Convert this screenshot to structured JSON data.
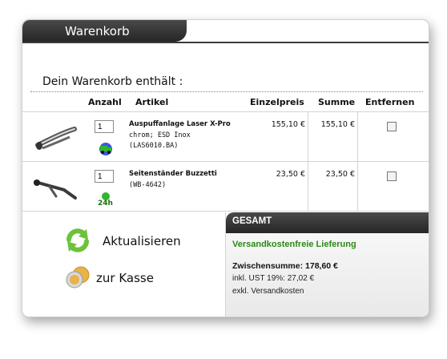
{
  "header": {
    "title": "Warenkorb"
  },
  "cart": {
    "intro": "Dein Warenkorb enthält :",
    "columns": {
      "quantity": "Anzahl",
      "article": "Artikel",
      "unit_price": "Einzelpreis",
      "total": "Summe",
      "remove": "Entfernen"
    },
    "items": [
      {
        "quantity": "1",
        "name": "Auspuffanlage Laser X-Pro",
        "details": "chrom; ESD Inox",
        "sku": "(LAS6010.BA)",
        "unit_price": "155,10 €",
        "total": "155,10 €",
        "remove_checked": false,
        "availability_icon": "delivery-truck-icon"
      },
      {
        "quantity": "1",
        "name": "Seitenständer Buzzetti",
        "sku": "(WB-4642)",
        "unit_price": "23,50 €",
        "total": "23,50 €",
        "remove_checked": false,
        "availability_icon": "24h-delivery-icon"
      }
    ]
  },
  "actions": {
    "update_label": "Aktualisieren",
    "checkout_label": "zur Kasse"
  },
  "summary": {
    "title": "GESAMT",
    "shipping_note": "Versandkostenfreie Lieferung",
    "subtotal": "Zwischensumme: 178,60 €",
    "vat": "inkl. UST 19%: 27,02 €",
    "shipping_excl": "exkl. Versandkosten"
  },
  "colors": {
    "accent_dark": "#2a2a2a",
    "green": "#2c8a17"
  }
}
